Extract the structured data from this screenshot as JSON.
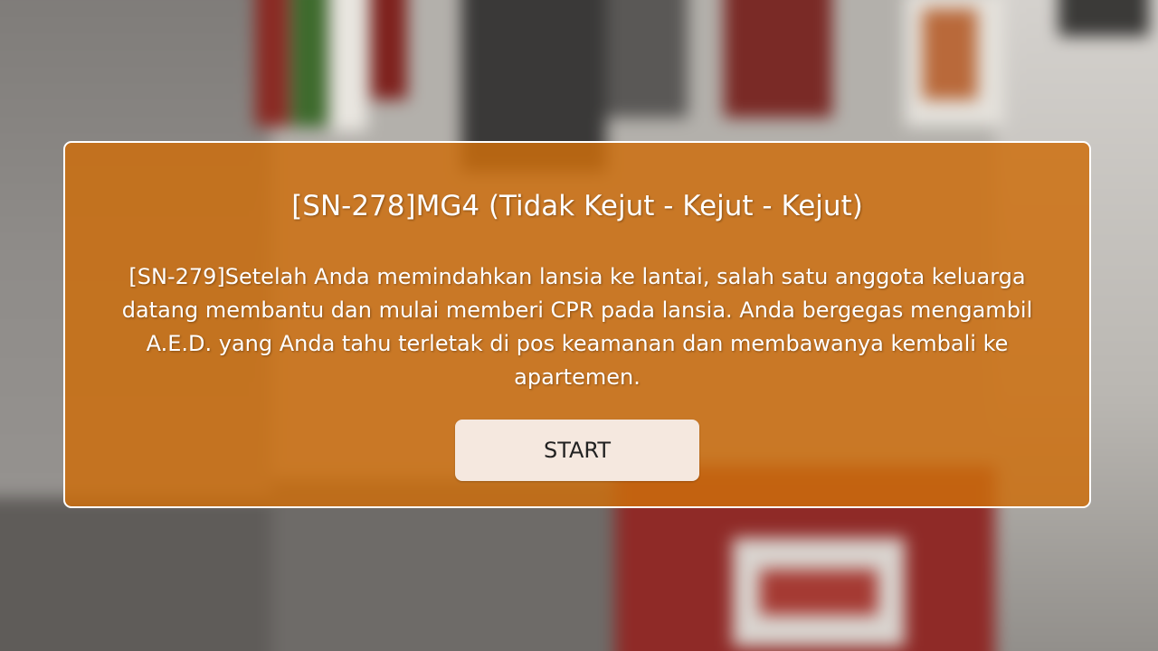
{
  "dialog": {
    "title": "[SN-278]MG4 (Tidak Kejut - Kejut - Kejut)",
    "body": "[SN-279]Setelah Anda memindahkan lansia ke lantai, salah satu anggota keluarga datang membantu dan mulai memberi CPR pada lansia. Anda bergegas mengambil A.E.D. yang Anda tahu terletak di pos keamanan dan membawanya kembali ke apartemen.",
    "start_label": "START"
  },
  "colors": {
    "dialog_background": "#cd6e0c",
    "dialog_border": "#ffffff",
    "button_background": "#f5e8df"
  }
}
